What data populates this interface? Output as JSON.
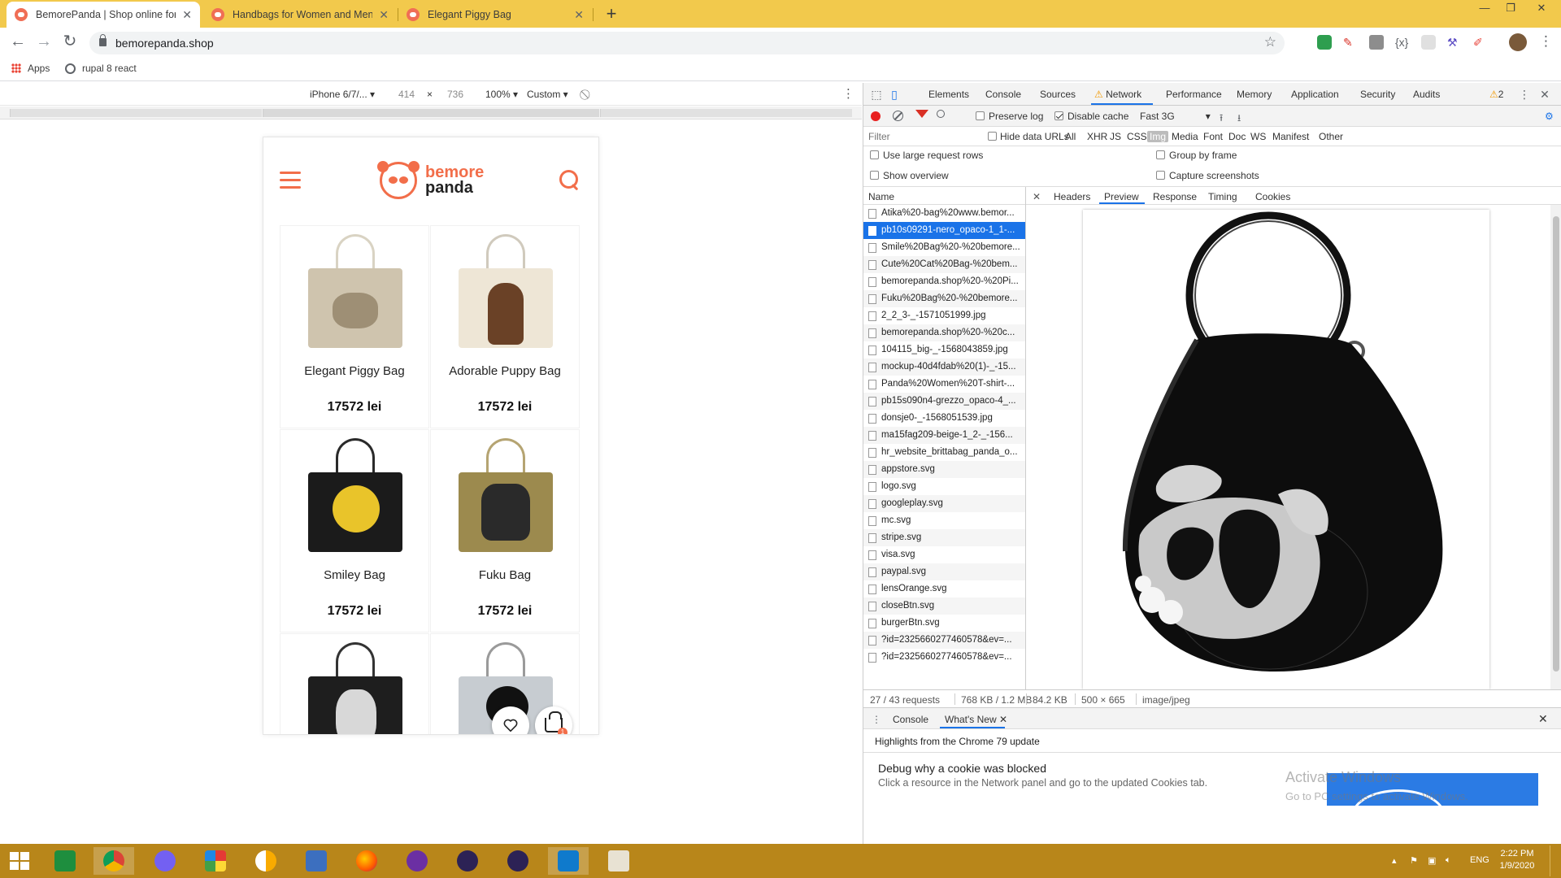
{
  "browser": {
    "tabs": [
      {
        "title": "BemorePanda | Shop online for S",
        "active": true
      },
      {
        "title": "Handbags for Women and Men",
        "active": false
      },
      {
        "title": "Elegant Piggy Bag",
        "active": false
      }
    ],
    "url": "bemorepanda.shop",
    "bookmarks": [
      {
        "label": "Apps",
        "icon": "apps-grid-icon"
      },
      {
        "label": "rupal 8 react",
        "icon": "globe-icon"
      }
    ]
  },
  "device_toolbar": {
    "device": "iPhone 6/7/...",
    "width": "414",
    "times": "×",
    "height": "736",
    "zoom": "100%",
    "throttle": "Custom"
  },
  "site": {
    "logo": {
      "line1": "bemore",
      "line2": "panda"
    },
    "products": [
      {
        "name": "Elegant Piggy Bag",
        "price": "17572 lei",
        "handle": "#d9d3c3",
        "body": "#cfc4ae",
        "accent": "#9e8f75"
      },
      {
        "name": "Adorable Puppy Bag",
        "price": "17572 lei",
        "handle": "#d0cabd",
        "body": "#eee6d6",
        "accent": "#6a4126"
      },
      {
        "name": "Smiley Bag",
        "price": "17572 lei",
        "handle": "#2a2a2a",
        "body": "#1b1b1b",
        "accent": "#e9c42a"
      },
      {
        "name": "Fuku Bag",
        "price": "17572 lei",
        "handle": "#b5a472",
        "body": "#9c8a4e",
        "accent": "#2a2a2a"
      },
      {
        "name": "",
        "price": "",
        "handle": "#333333",
        "body": "#1e1e1e",
        "accent": "#d8d8d8"
      },
      {
        "name": "",
        "price": "",
        "handle": "#9a9a9a",
        "body": "#c7ccd1",
        "accent": "#111111"
      }
    ],
    "cart_count": "1",
    "accent_color": "#f26e4a"
  },
  "devtools": {
    "tabs": [
      "Elements",
      "Console",
      "Sources",
      "Network",
      "Performance",
      "Memory",
      "Application",
      "Security",
      "Audits"
    ],
    "active_tab": "Network",
    "warnings": "2",
    "toolbar": {
      "preserve_log": "Preserve log",
      "disable_cache": "Disable cache",
      "throttling": "Fast 3G"
    },
    "filter": {
      "placeholder": "Filter",
      "hide_data_urls": "Hide data URLs",
      "types": [
        "All",
        "XHR",
        "JS",
        "CSS",
        "Img",
        "Media",
        "Font",
        "Doc",
        "WS",
        "Manifest",
        "Other"
      ],
      "selected_type": "Img"
    },
    "options": {
      "large_rows": "Use large request rows",
      "group_by_frame": "Group by frame",
      "show_overview": "Show overview",
      "capture_screenshots": "Capture screenshots"
    },
    "requests": {
      "header": "Name",
      "selected_index": 1,
      "rows": [
        "Atika%20-bag%20www.bemor...",
        "pb10s09291-nero_opaco-1_1-...",
        "Smile%20Bag%20-%20bemore...",
        "Cute%20Cat%20Bag-%20bem...",
        "bemorepanda.shop%20-%20Pi...",
        "Fuku%20Bag%20-%20bemore...",
        "2_2_3-_-1571051999.jpg",
        "bemorepanda.shop%20-%20c...",
        "104115_big-_-1568043859.jpg",
        "mockup-40d4fdab%20(1)-_-15...",
        "Panda%20Women%20T-shirt-...",
        "pb15s090n4-grezzo_opaco-4_...",
        "donsje0-_-1568051539.jpg",
        "ma15fag209-beige-1_2-_-156...",
        "hr_website_brittabag_panda_o...",
        "appstore.svg",
        "logo.svg",
        "googleplay.svg",
        "mc.svg",
        "stripe.svg",
        "visa.svg",
        "paypal.svg",
        "lensOrange.svg",
        "closeBtn.svg",
        "burgerBtn.svg",
        "?id=2325660277460578&ev=...",
        "?id=2325660277460578&ev=..."
      ]
    },
    "detail_tabs": [
      "Headers",
      "Preview",
      "Response",
      "Timing",
      "Cookies"
    ],
    "active_detail_tab": "Preview",
    "status": {
      "requests": "27 / 43 requests",
      "transferred": "768 KB / 1.2 MB",
      "size": "84.2 KB",
      "dimensions": "500 × 665",
      "mime": "image/jpeg"
    },
    "drawer": {
      "tabs": [
        "Console",
        "What's New"
      ],
      "active_tab": "What's New",
      "highlight": "Highlights from the Chrome 79 update",
      "item_title": "Debug why a cookie was blocked",
      "item_desc": "Click a resource in the Network panel and go to the updated Cookies tab."
    }
  },
  "watermark": {
    "title": "Activate Windows",
    "subtitle": "Go to PC settings to activate Windows."
  },
  "taskbar": {
    "lang": "ENG",
    "time": "2:22 PM",
    "date": "1/9/2020"
  }
}
